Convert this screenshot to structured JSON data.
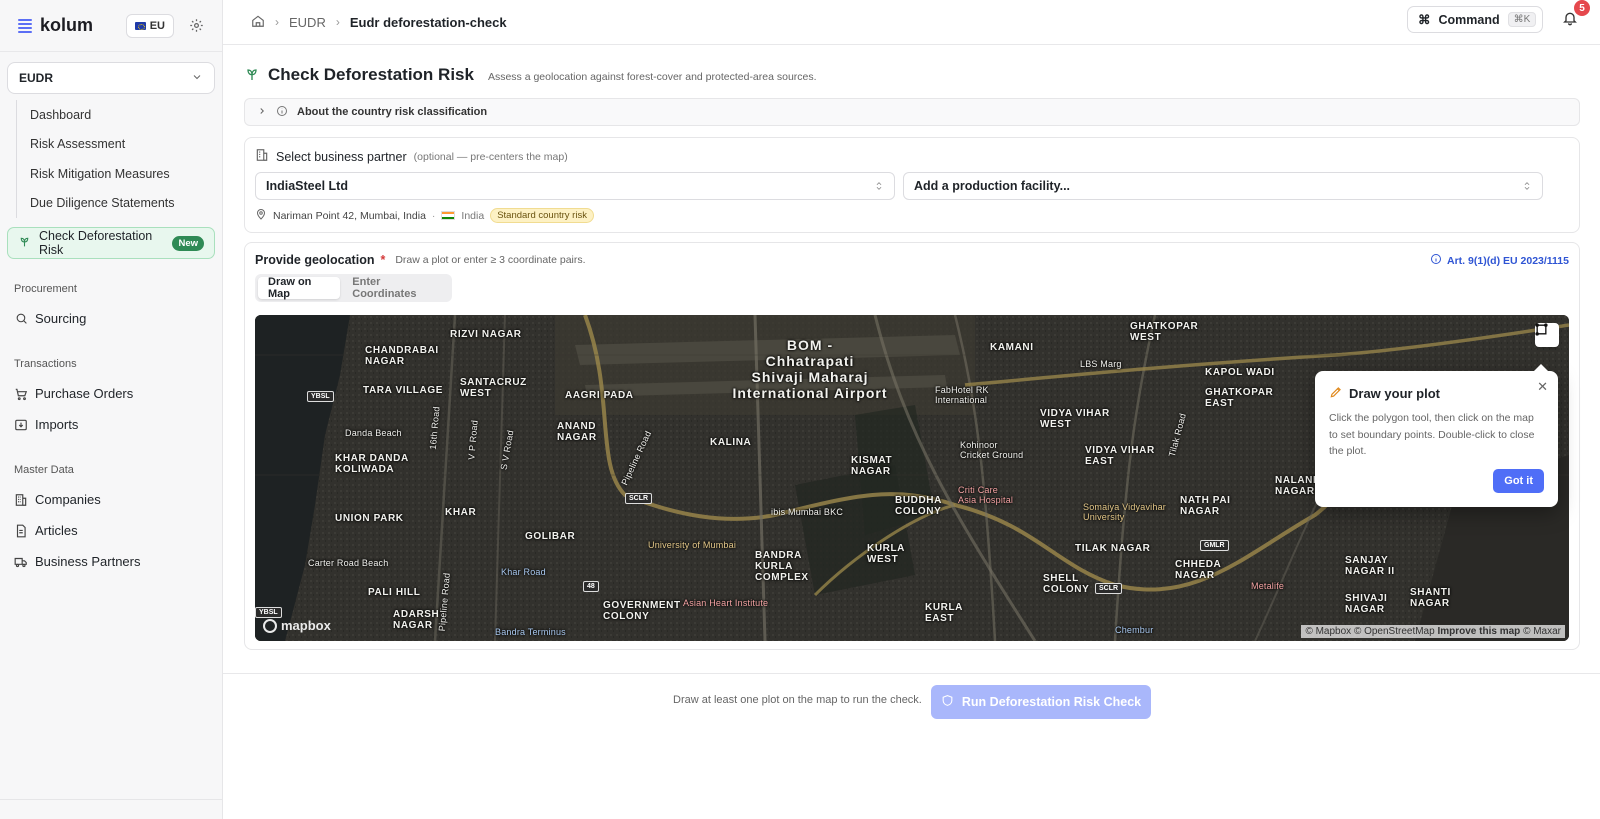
{
  "app": {
    "brand": "kolum",
    "region": "EU"
  },
  "sidebar": {
    "module": "EUDR",
    "subnav": [
      {
        "label": "Dashboard"
      },
      {
        "label": "Risk Assessment"
      },
      {
        "label": "Risk Mitigation Measures"
      },
      {
        "label": "Due Diligence Statements"
      }
    ],
    "active": {
      "label": "Check Deforestation Risk",
      "badge": "New"
    },
    "sections": {
      "procurement": {
        "title": "Procurement",
        "items": [
          {
            "label": "Sourcing",
            "icon": "search-icon"
          }
        ]
      },
      "transactions": {
        "title": "Transactions",
        "items": [
          {
            "label": "Purchase Orders",
            "icon": "cart-icon"
          },
          {
            "label": "Imports",
            "icon": "import-icon"
          }
        ]
      },
      "master_data": {
        "title": "Master Data",
        "items": [
          {
            "label": "Companies",
            "icon": "building-icon"
          },
          {
            "label": "Articles",
            "icon": "document-icon"
          },
          {
            "label": "Business Partners",
            "icon": "truck-icon"
          }
        ]
      }
    }
  },
  "header": {
    "breadcrumb": [
      "EUDR",
      "Eudr deforestation-check"
    ],
    "command_label": "Command",
    "command_shortcut": "⌘K",
    "notification_count": "5"
  },
  "page": {
    "title": "Check Deforestation Risk",
    "subtitle": "Assess a geolocation against forest-cover and protected-area sources.",
    "about_label": "About the country risk classification"
  },
  "partner": {
    "heading": "Select business partner",
    "optional_note": "(optional — pre-centers the map)",
    "selected_partner": "IndiaSteel Ltd",
    "facility_placeholder": "Add a production facility...",
    "address": "Nariman Point 42, Mumbai, India",
    "separator": "·",
    "country": "India",
    "risk_badge": "Standard country risk"
  },
  "geo": {
    "heading": "Provide geolocation",
    "required_mark": "*",
    "hint": "Draw a plot or enter ≥ 3 coordinate pairs.",
    "article_ref": "Art. 9(1)(d) EU 2023/1115",
    "tabs": [
      {
        "label": "Draw on Map",
        "active": true
      },
      {
        "label": "Enter Coordinates",
        "active": false
      }
    ]
  },
  "map": {
    "labels": {
      "chandrabai": "CHANDRABAI\nNAGAR",
      "rizvi": "RIZVI NAGAR",
      "airport": "BOM -\nChhatrapati\nShivaji Maharaj\nInternational Airport",
      "kamani": "KAMANI",
      "ghatkopar_w": "GHATKOPAR\nWEST",
      "tara": "TARA VILLAGE",
      "santacruz": "SANTACRUZ\nWEST",
      "aagri": "AAGRI PADA",
      "lbs": "LBS Marg",
      "kapol": "KAPOL WADI",
      "ghatkopar_e": "GHATKOPAR\nEAST",
      "fabhotel": "FabHotel RK\nInternational",
      "vidyavihar_w": "VIDYA VIHAR\nWEST",
      "danda": "Danda Beach",
      "anand": "ANAND\nNAGAR",
      "kalina": "KALINA",
      "kohinoor": "Kohinoor\nCricket Ground",
      "vidyavihar_e": "VIDYA VIHAR\nEAST",
      "khar_danda": "KHAR DANDA\nKOLIWADA",
      "kismat": "KISMAT\nNAGAR",
      "critical": "Criti Care\nAsia Hospital",
      "nalanda": "NALANDA\nNAGAR",
      "union": "UNION PARK",
      "khar": "KHAR",
      "ibis": "ibis Mumbai BKC",
      "buddha": "BUDDHA\nCOLONY",
      "somaiya": "Somaiya Vidyavihar\nUniversity",
      "nathpai": "NATH PAI\nNAGAR",
      "golibar": "GOLIBAR",
      "uni_mumbai": "University of Mumbai",
      "tilak": "TILAK NAGAR",
      "carter": "Carter Road Beach",
      "khar_road": "Khar Road",
      "bandra_kurla": "BANDRA\nKURLA\nCOMPLEX",
      "kurla_w": "KURLA\nWEST",
      "shell": "SHELL\nCOLONY",
      "chheda": "CHHEDA\nNAGAR",
      "sanjay": "SANJAY\nNAGAR II",
      "pali": "PALI HILL",
      "asian": "Asian Heart Institute",
      "govt": "GOVERNMENT\nCOLONY",
      "adarsh": "ADARSH\nNAGAR",
      "kurla_e": "KURLA\nEAST",
      "metalife": "Metalife",
      "shivaji": "SHIVAJI\nNAGAR",
      "shanti": "SHANTI\nNAGAR",
      "bandra_t": "Bandra Terminus",
      "chembur": "Chembur",
      "sclr1": "SCLR",
      "sclr2": "SCLR",
      "gmlr": "GMLR",
      "ybsl1": "YBSL",
      "ybsl2": "YBSL",
      "road16": "16th Road",
      "vp": "V P Road",
      "sv": "S V Road",
      "pipeline": "Pipeline Road",
      "tilak_rd": "Tilak Road",
      "pipeline2": "Pipeline Road",
      "rd48": "48"
    },
    "mapbox_logo": "mapbox",
    "attribution": "© Mapbox © OpenStreetMap",
    "attribution_link": "Improve this map",
    "attribution_tail": "© Maxar"
  },
  "popover": {
    "title": "Draw your plot",
    "body": "Click the polygon tool, then click on the map to set boundary points. Double-click to close the plot.",
    "button": "Got it"
  },
  "footer": {
    "hint": "Draw at least one plot on the map to run the check.",
    "run_button": "Run Deforestation Risk Check"
  }
}
